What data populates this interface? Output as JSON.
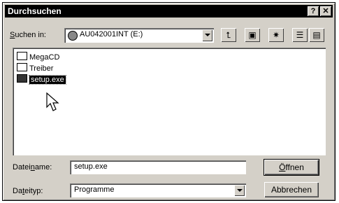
{
  "window": {
    "title": "Durchsuchen"
  },
  "titlebar": {
    "help_label": "?",
    "close_label": "✕"
  },
  "lookin": {
    "label_pre": "",
    "label_u": "S",
    "label_post": "uchen in:",
    "value": "AU042001INT (E:)"
  },
  "toolbar": {
    "up_icon": "folder-up-icon",
    "desktop_icon": "desktop-icon",
    "newfolder_icon": "new-folder-icon",
    "list_icon": "list-view-icon",
    "details_icon": "details-view-icon"
  },
  "files": [
    {
      "name": "MegaCD",
      "type": "folder"
    },
    {
      "name": "Treiber",
      "type": "folder"
    },
    {
      "name": "setup.exe",
      "type": "file",
      "selected": true
    }
  ],
  "filename": {
    "label_pre": "Datei",
    "label_u": "n",
    "label_post": "ame:",
    "value": "setup.exe"
  },
  "filetype": {
    "label_pre": "Da",
    "label_u": "t",
    "label_post": "eityp:",
    "value": "Programme"
  },
  "buttons": {
    "open_pre": "",
    "open_u": "Ö",
    "open_post": "ffnen",
    "cancel": "Abbrechen"
  }
}
